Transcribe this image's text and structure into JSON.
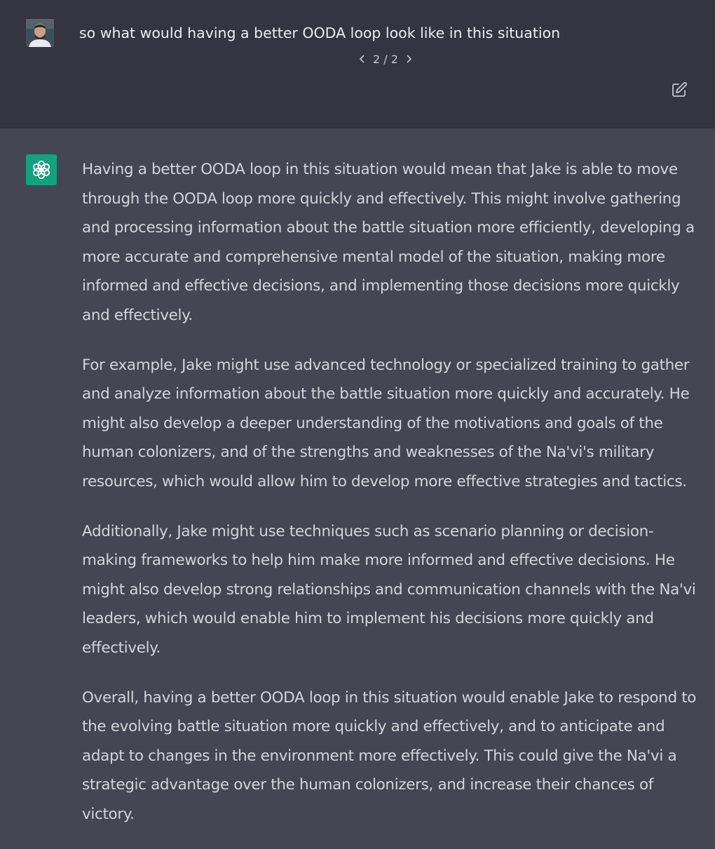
{
  "user_message": {
    "text": "so what would having a better OODA loop look like in this situation",
    "pager": "2 / 2"
  },
  "assistant_message": {
    "paragraphs": [
      "Having a better OODA loop in this situation would mean that Jake is able to move through the OODA loop more quickly and effectively. This might involve gathering and processing information about the battle situation more efficiently, developing a more accurate and comprehensive mental model of the situation, making more informed and effective decisions, and implementing those decisions more quickly and effectively.",
      "For example, Jake might use advanced technology or specialized training to gather and analyze information about the battle situation more quickly and accurately. He might also develop a deeper understanding of the motivations and goals of the human colonizers, and of the strengths and weaknesses of the Na'vi's military resources, which would allow him to develop more effective strategies and tactics.",
      "Additionally, Jake might use techniques such as scenario planning or decision-making frameworks to help him make more informed and effective decisions. He might also develop strong relationships and communication channels with the Na'vi leaders, which would enable him to implement his decisions more quickly and effectively.",
      "Overall, having a better OODA loop in this situation would enable Jake to respond to the evolving battle situation more quickly and effectively, and to anticipate and adapt to changes in the environment more effectively. This could give the Na'vi a strategic advantage over the human colonizers, and increase their chances of victory."
    ]
  },
  "icons": {
    "prev": "chevron-left-icon",
    "next": "chevron-right-icon",
    "edit": "edit-icon",
    "assistant": "openai-logo-icon"
  },
  "colors": {
    "user_bg": "#343541",
    "assistant_bg": "#444654",
    "assistant_avatar": "#10a37f",
    "text": "#d1d5db"
  }
}
